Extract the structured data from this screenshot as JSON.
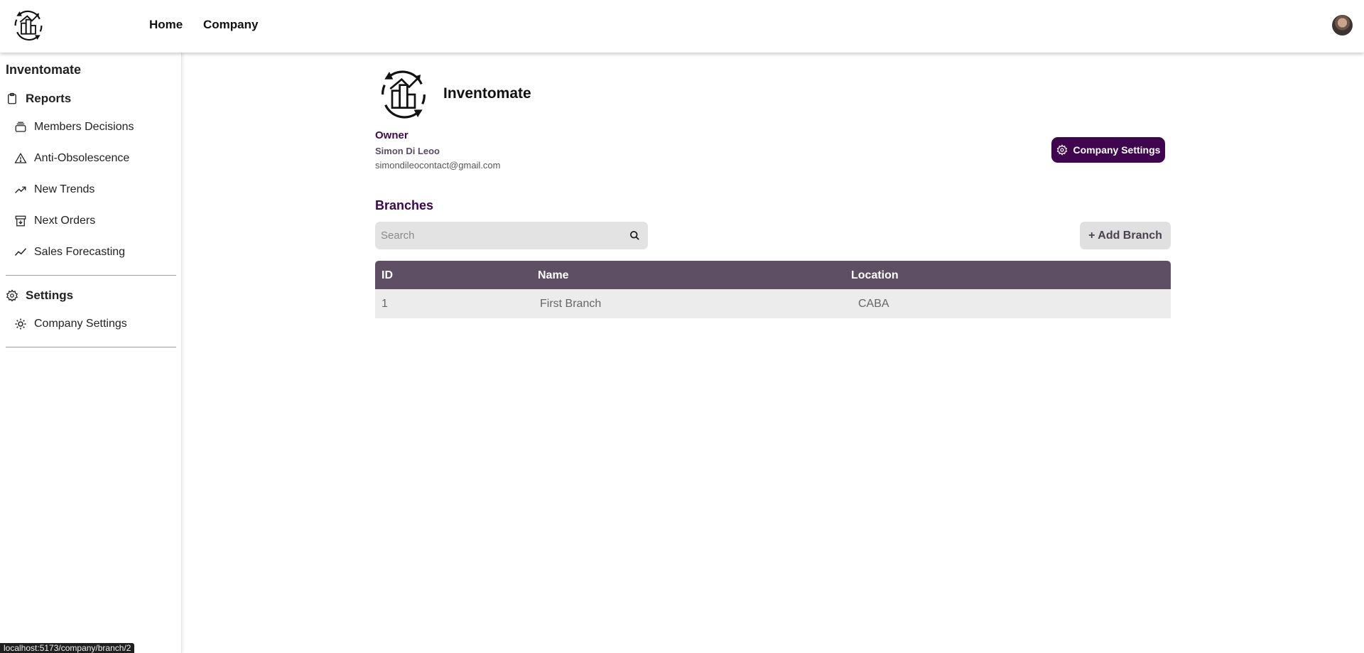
{
  "topbar": {
    "nav": [
      {
        "label": "Home"
      },
      {
        "label": "Company"
      }
    ]
  },
  "sidebar": {
    "brand": "Inventomate",
    "reports": {
      "label": "Reports",
      "icon": "clipboard-icon",
      "items": [
        {
          "label": "Members Decisions",
          "icon": "stack-icon"
        },
        {
          "label": "Anti-Obsolescence",
          "icon": "warning-icon"
        },
        {
          "label": "New Trends",
          "icon": "trending-up-icon"
        },
        {
          "label": "Next Orders",
          "icon": "archive-download-icon"
        },
        {
          "label": "Sales Forecasting",
          "icon": "chart-line-icon"
        }
      ]
    },
    "settings": {
      "label": "Settings",
      "icon": "gear-icon",
      "items": [
        {
          "label": "Company Settings",
          "icon": "cog-icon"
        }
      ]
    }
  },
  "company": {
    "name": "Inventomate",
    "owner_label": "Owner",
    "owner_name": "Simon Di Leoo",
    "owner_email": "simondileocontact@gmail.com",
    "settings_button": "Company Settings"
  },
  "branches": {
    "title": "Branches",
    "search_placeholder": "Search",
    "search_value": "",
    "add_button": "+ Add Branch",
    "columns": [
      "ID",
      "Name",
      "Location"
    ],
    "rows": [
      {
        "id": "1",
        "name": "First Branch",
        "location": "CABA"
      }
    ]
  },
  "status_bar": {
    "url": "localhost:5173/company/branch/2"
  },
  "colors": {
    "accent": "#40054f",
    "table_header": "#5e4f64",
    "row_bg": "#ececec"
  }
}
